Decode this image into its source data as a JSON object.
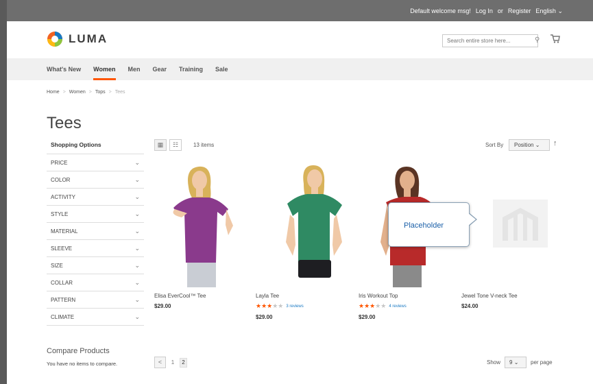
{
  "topbar": {
    "welcome": "Default welcome msg!",
    "login": "Log In",
    "or": "or",
    "register": "Register",
    "language": "English"
  },
  "header": {
    "logo_text": "LUMA",
    "search_placeholder": "Search entire store here..."
  },
  "nav": {
    "items": [
      {
        "label": "What's New"
      },
      {
        "label": "Women",
        "active": true
      },
      {
        "label": "Men"
      },
      {
        "label": "Gear"
      },
      {
        "label": "Training"
      },
      {
        "label": "Sale"
      }
    ]
  },
  "breadcrumb": [
    "Home",
    "Women",
    "Tops",
    "Tees"
  ],
  "page_title": "Tees",
  "sidebar": {
    "title": "Shopping Options",
    "filters": [
      "Price",
      "Color",
      "Activity",
      "Style",
      "Material",
      "Sleeve",
      "Size",
      "Collar",
      "Pattern",
      "Climate"
    ]
  },
  "compare": {
    "title": "Compare Products",
    "empty": "You have no items to compare."
  },
  "toolbar": {
    "count": "13 items",
    "sort_label": "Sort By",
    "sort_value": "Position",
    "sort_dir_icon": "arrow-up-icon"
  },
  "products": [
    {
      "name": "Elisa EverCool™ Tee",
      "price": "$29.00",
      "shirt_color": "#8a3a8c",
      "shorts_color": "#c9cdd4"
    },
    {
      "name": "Layla Tee",
      "price": "$29.00",
      "rating": 3,
      "reviews": "3 reviews",
      "shirt_color": "#2f8a63",
      "shorts_color": "#1e1e22"
    },
    {
      "name": "Iris Workout Top",
      "price": "$29.00",
      "rating": 3,
      "reviews": "4 reviews",
      "shirt_color": "#b82a2a",
      "shorts_color": "#8a8a8a"
    },
    {
      "name": "Jewel Tone V-neck Tee",
      "price": "$24.00"
    }
  ],
  "callout": {
    "text": "Placeholder"
  },
  "pager": {
    "pages": [
      "1",
      "2"
    ],
    "current": "2"
  },
  "limiter": {
    "show": "Show",
    "value": "9",
    "per_page": "per page"
  },
  "colors": {
    "accent": "#ff5501",
    "link": "#1979c3"
  }
}
